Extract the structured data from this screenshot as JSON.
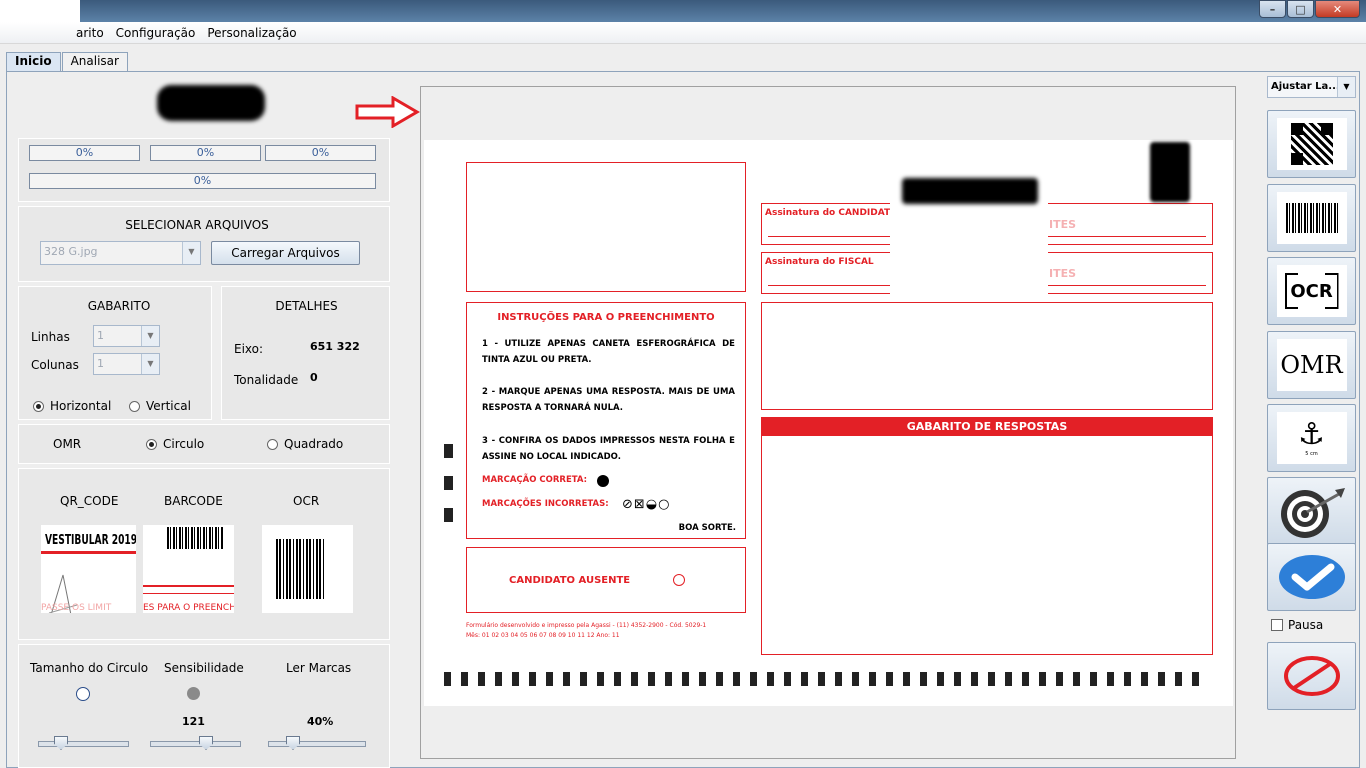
{
  "window": {
    "minimize": "–",
    "maximize": "□",
    "close": "✕"
  },
  "menu": [
    "arito",
    "Configuração",
    "Personalização"
  ],
  "tabs": [
    "Inicio",
    "Analisar"
  ],
  "progress": [
    "0%",
    "0%",
    "0%",
    "0%"
  ],
  "files": {
    "title": "SELECIONAR ARQUIVOS",
    "selected": "328 G.jpg",
    "load_button": "Carregar Arquivos"
  },
  "gabarito": {
    "title": "GABARITO",
    "rows_label": "Linhas",
    "rows_value": "1",
    "cols_label": "Colunas",
    "cols_value": "1",
    "horizontal": "Horizontal",
    "vertical": "Vertical"
  },
  "detalhes": {
    "title": "DETALHES",
    "eixo_label": "Eixo:",
    "eixo_value": "651 322",
    "tonalidade_label": "Tonalidade",
    "tonalidade_value": "0"
  },
  "omr": {
    "label": "OMR",
    "circulo": "Circulo",
    "quadrado": "Quadrado"
  },
  "previews": {
    "qr": "QR_CODE",
    "barcode": "BARCODE",
    "ocr": "OCR",
    "qr_text": "VESTIBULAR 2019",
    "qr_sub": "PASSE OS LIMIT",
    "barcode_sub": "ES PARA O PREENCHIM"
  },
  "sliders": {
    "circle_label": "Tamanho do Circulo",
    "sens_label": "Sensibilidade",
    "sens_value": "121",
    "marks_label": "Ler Marcas",
    "marks_value": "40%"
  },
  "zoom": {
    "selected": "Ajustar La..."
  },
  "sidebar": {
    "ocr_text": "OCR",
    "omr_text": "OMR",
    "anchor_sub": "5 cm",
    "pause": "Pausa"
  },
  "form": {
    "sig_candidato": "Assinatura do CANDIDATO",
    "sig_fiscal": "Assinatura do FISCAL",
    "ites": "ITES",
    "instr_title": "INSTRUÇÕES PARA O PREENCHIMENTO",
    "instr1": "1 - UTILIZE APENAS CANETA ESFEROGRÁFICA DE TINTA AZUL OU PRETA.",
    "instr2": "2 - MARQUE APENAS UMA RESPOSTA. MAIS DE UMA RESPOSTA A TORNARÁ NULA.",
    "instr3": "3 - CONFIRA OS DADOS IMPRESSOS NESTA FOLHA E ASSINE NO LOCAL INDICADO.",
    "correct": "MARCAÇÃO CORRETA:",
    "incorrect": "MARCAÇÕES INCORRETAS:",
    "luck": "BOA SORTE.",
    "absent": "CANDIDATO AUSENTE",
    "gabarito_header": "GABARITO DE RESPOSTAS",
    "footer1": "Formulário desenvolvido e impresso pela Agassi - (11) 4352-2900 - Cód. 5029-1",
    "footer2": "Mês: 01 02 03 04 05 06 07 08 09 10 11 12   Ano: 11"
  },
  "colors": {
    "accent_red": "#e32026",
    "title_blue": "#3b5a7c"
  }
}
